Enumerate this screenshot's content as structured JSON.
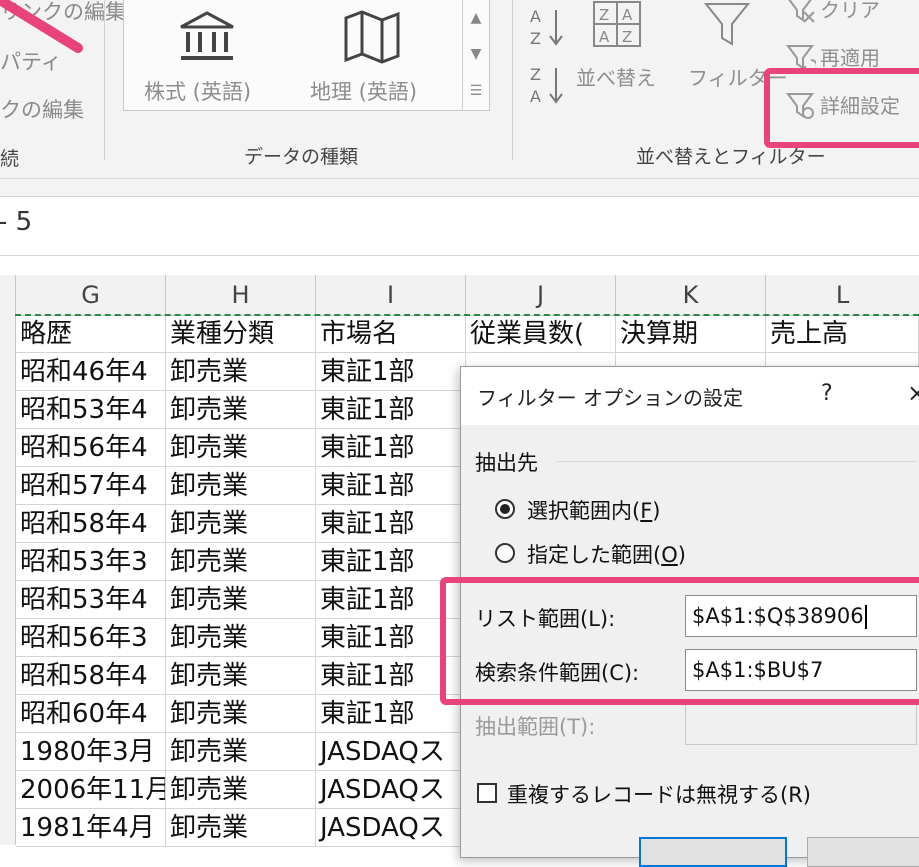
{
  "ribbon": {
    "left_items": [
      "リンクの編集",
      "パティ",
      "クの編集"
    ],
    "left_group_label": "続",
    "data_types": {
      "items": [
        {
          "label": "株式 (英語)",
          "icon": "bank-icon"
        },
        {
          "label": "地理 (英語)",
          "icon": "map-icon"
        }
      ],
      "group_label": "データの種類"
    },
    "sort_filter": {
      "sort_az_label": "A→Z",
      "sort_za_label": "Z→A",
      "sort_button_label": "並べ替え",
      "filter_label": "フィルター",
      "clear_label": "クリア",
      "reapply_label": "再適用",
      "advanced_label": "詳細設定",
      "group_label": "並べ替えとフィルター"
    }
  },
  "formula_bar": {
    "text": "- 5"
  },
  "grid": {
    "columns": [
      "G",
      "H",
      "I",
      "J",
      "K",
      "L"
    ],
    "header_row": [
      "略歴",
      "業種分類",
      "市場名",
      "従業員数(",
      "決算期",
      "売上高"
    ],
    "rows": [
      [
        "昭和46年4",
        "卸売業",
        "東証1部"
      ],
      [
        "昭和53年4",
        "卸売業",
        "東証1部"
      ],
      [
        "昭和56年4",
        "卸売業",
        "東証1部"
      ],
      [
        "昭和57年4",
        "卸売業",
        "東証1部"
      ],
      [
        "昭和58年4",
        "卸売業",
        "東証1部"
      ],
      [
        "昭和53年3",
        "卸売業",
        "東証1部"
      ],
      [
        "昭和53年4",
        "卸売業",
        "東証1部"
      ],
      [
        "昭和56年3",
        "卸売業",
        "東証1部"
      ],
      [
        "昭和58年4",
        "卸売業",
        "東証1部"
      ],
      [
        "昭和60年4",
        "卸売業",
        "東証1部"
      ],
      [
        "1980年3月",
        "卸売業",
        "JASDAQス"
      ],
      [
        "2006年11月",
        "卸売業",
        "JASDAQス"
      ],
      [
        "1981年4月",
        "卸売業",
        "JASDAQス"
      ]
    ]
  },
  "dialog": {
    "title": "フィルター オプションの設定",
    "help": "?",
    "close": "×",
    "section_label": "抽出先",
    "radio_in_place": "選択範囲内(F)",
    "radio_in_place_key": "F",
    "radio_copy": "指定した範囲(O)",
    "radio_copy_key": "O",
    "list_range_label": "リスト範囲(L):",
    "list_range_value": "$A$1:$Q$38906",
    "criteria_range_label": "検索条件範囲(C):",
    "criteria_range_value": "$A$1:$BU$7",
    "copy_to_label": "抽出範囲(T):",
    "copy_to_value": "",
    "unique_label": "重複するレコードは無視する(R)"
  },
  "colors": {
    "highlight": "#e8437a",
    "marquee": "#2a8a4c",
    "ribbon_bg": "#f3f3f3"
  }
}
